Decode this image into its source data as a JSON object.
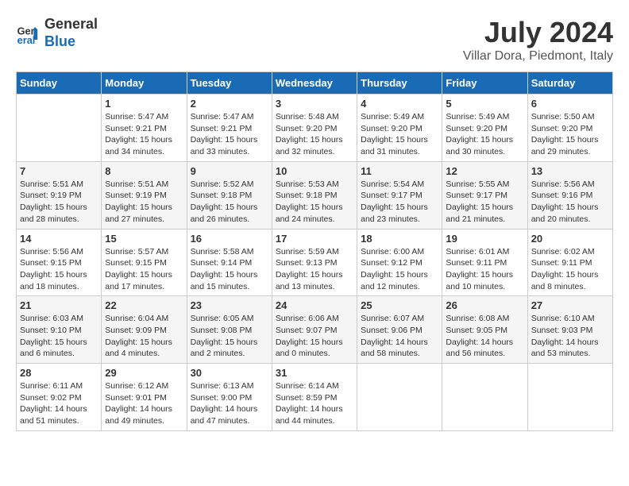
{
  "header": {
    "logo_line1": "General",
    "logo_line2": "Blue",
    "title": "July 2024",
    "subtitle": "Villar Dora, Piedmont, Italy"
  },
  "weekdays": [
    "Sunday",
    "Monday",
    "Tuesday",
    "Wednesday",
    "Thursday",
    "Friday",
    "Saturday"
  ],
  "weeks": [
    [
      {
        "day": "",
        "sunrise": "",
        "sunset": "",
        "daylight": ""
      },
      {
        "day": "1",
        "sunrise": "Sunrise: 5:47 AM",
        "sunset": "Sunset: 9:21 PM",
        "daylight": "Daylight: 15 hours and 34 minutes."
      },
      {
        "day": "2",
        "sunrise": "Sunrise: 5:47 AM",
        "sunset": "Sunset: 9:21 PM",
        "daylight": "Daylight: 15 hours and 33 minutes."
      },
      {
        "day": "3",
        "sunrise": "Sunrise: 5:48 AM",
        "sunset": "Sunset: 9:20 PM",
        "daylight": "Daylight: 15 hours and 32 minutes."
      },
      {
        "day": "4",
        "sunrise": "Sunrise: 5:49 AM",
        "sunset": "Sunset: 9:20 PM",
        "daylight": "Daylight: 15 hours and 31 minutes."
      },
      {
        "day": "5",
        "sunrise": "Sunrise: 5:49 AM",
        "sunset": "Sunset: 9:20 PM",
        "daylight": "Daylight: 15 hours and 30 minutes."
      },
      {
        "day": "6",
        "sunrise": "Sunrise: 5:50 AM",
        "sunset": "Sunset: 9:20 PM",
        "daylight": "Daylight: 15 hours and 29 minutes."
      }
    ],
    [
      {
        "day": "7",
        "sunrise": "Sunrise: 5:51 AM",
        "sunset": "Sunset: 9:19 PM",
        "daylight": "Daylight: 15 hours and 28 minutes."
      },
      {
        "day": "8",
        "sunrise": "Sunrise: 5:51 AM",
        "sunset": "Sunset: 9:19 PM",
        "daylight": "Daylight: 15 hours and 27 minutes."
      },
      {
        "day": "9",
        "sunrise": "Sunrise: 5:52 AM",
        "sunset": "Sunset: 9:18 PM",
        "daylight": "Daylight: 15 hours and 26 minutes."
      },
      {
        "day": "10",
        "sunrise": "Sunrise: 5:53 AM",
        "sunset": "Sunset: 9:18 PM",
        "daylight": "Daylight: 15 hours and 24 minutes."
      },
      {
        "day": "11",
        "sunrise": "Sunrise: 5:54 AM",
        "sunset": "Sunset: 9:17 PM",
        "daylight": "Daylight: 15 hours and 23 minutes."
      },
      {
        "day": "12",
        "sunrise": "Sunrise: 5:55 AM",
        "sunset": "Sunset: 9:17 PM",
        "daylight": "Daylight: 15 hours and 21 minutes."
      },
      {
        "day": "13",
        "sunrise": "Sunrise: 5:56 AM",
        "sunset": "Sunset: 9:16 PM",
        "daylight": "Daylight: 15 hours and 20 minutes."
      }
    ],
    [
      {
        "day": "14",
        "sunrise": "Sunrise: 5:56 AM",
        "sunset": "Sunset: 9:15 PM",
        "daylight": "Daylight: 15 hours and 18 minutes."
      },
      {
        "day": "15",
        "sunrise": "Sunrise: 5:57 AM",
        "sunset": "Sunset: 9:15 PM",
        "daylight": "Daylight: 15 hours and 17 minutes."
      },
      {
        "day": "16",
        "sunrise": "Sunrise: 5:58 AM",
        "sunset": "Sunset: 9:14 PM",
        "daylight": "Daylight: 15 hours and 15 minutes."
      },
      {
        "day": "17",
        "sunrise": "Sunrise: 5:59 AM",
        "sunset": "Sunset: 9:13 PM",
        "daylight": "Daylight: 15 hours and 13 minutes."
      },
      {
        "day": "18",
        "sunrise": "Sunrise: 6:00 AM",
        "sunset": "Sunset: 9:12 PM",
        "daylight": "Daylight: 15 hours and 12 minutes."
      },
      {
        "day": "19",
        "sunrise": "Sunrise: 6:01 AM",
        "sunset": "Sunset: 9:11 PM",
        "daylight": "Daylight: 15 hours and 10 minutes."
      },
      {
        "day": "20",
        "sunrise": "Sunrise: 6:02 AM",
        "sunset": "Sunset: 9:11 PM",
        "daylight": "Daylight: 15 hours and 8 minutes."
      }
    ],
    [
      {
        "day": "21",
        "sunrise": "Sunrise: 6:03 AM",
        "sunset": "Sunset: 9:10 PM",
        "daylight": "Daylight: 15 hours and 6 minutes."
      },
      {
        "day": "22",
        "sunrise": "Sunrise: 6:04 AM",
        "sunset": "Sunset: 9:09 PM",
        "daylight": "Daylight: 15 hours and 4 minutes."
      },
      {
        "day": "23",
        "sunrise": "Sunrise: 6:05 AM",
        "sunset": "Sunset: 9:08 PM",
        "daylight": "Daylight: 15 hours and 2 minutes."
      },
      {
        "day": "24",
        "sunrise": "Sunrise: 6:06 AM",
        "sunset": "Sunset: 9:07 PM",
        "daylight": "Daylight: 15 hours and 0 minutes."
      },
      {
        "day": "25",
        "sunrise": "Sunrise: 6:07 AM",
        "sunset": "Sunset: 9:06 PM",
        "daylight": "Daylight: 14 hours and 58 minutes."
      },
      {
        "day": "26",
        "sunrise": "Sunrise: 6:08 AM",
        "sunset": "Sunset: 9:05 PM",
        "daylight": "Daylight: 14 hours and 56 minutes."
      },
      {
        "day": "27",
        "sunrise": "Sunrise: 6:10 AM",
        "sunset": "Sunset: 9:03 PM",
        "daylight": "Daylight: 14 hours and 53 minutes."
      }
    ],
    [
      {
        "day": "28",
        "sunrise": "Sunrise: 6:11 AM",
        "sunset": "Sunset: 9:02 PM",
        "daylight": "Daylight: 14 hours and 51 minutes."
      },
      {
        "day": "29",
        "sunrise": "Sunrise: 6:12 AM",
        "sunset": "Sunset: 9:01 PM",
        "daylight": "Daylight: 14 hours and 49 minutes."
      },
      {
        "day": "30",
        "sunrise": "Sunrise: 6:13 AM",
        "sunset": "Sunset: 9:00 PM",
        "daylight": "Daylight: 14 hours and 47 minutes."
      },
      {
        "day": "31",
        "sunrise": "Sunrise: 6:14 AM",
        "sunset": "Sunset: 8:59 PM",
        "daylight": "Daylight: 14 hours and 44 minutes."
      },
      {
        "day": "",
        "sunrise": "",
        "sunset": "",
        "daylight": ""
      },
      {
        "day": "",
        "sunrise": "",
        "sunset": "",
        "daylight": ""
      },
      {
        "day": "",
        "sunrise": "",
        "sunset": "",
        "daylight": ""
      }
    ]
  ]
}
